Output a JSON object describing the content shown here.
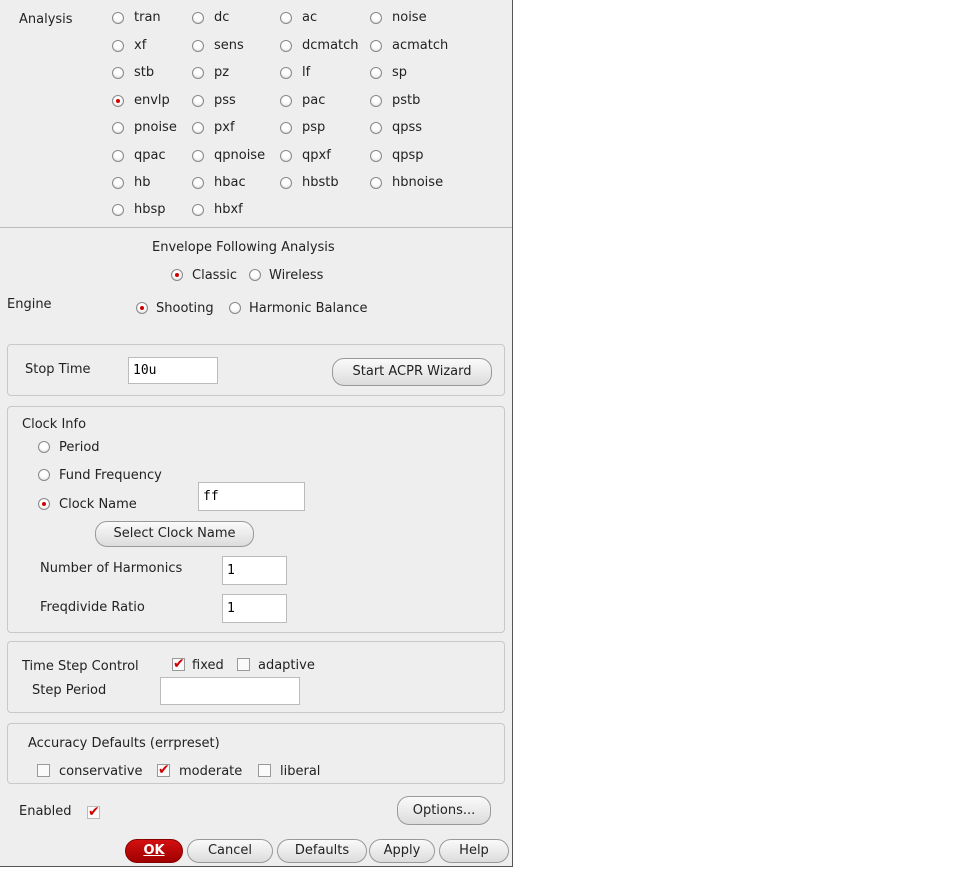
{
  "analysis": {
    "label": "Analysis",
    "selected": "envlp",
    "options": [
      [
        "tran",
        "dc",
        "ac",
        "noise"
      ],
      [
        "xf",
        "sens",
        "dcmatch",
        "acmatch"
      ],
      [
        "stb",
        "pz",
        "lf",
        "sp"
      ],
      [
        "envlp",
        "pss",
        "pac",
        "pstb"
      ],
      [
        "pnoise",
        "pxf",
        "psp",
        "qpss"
      ],
      [
        "qpac",
        "qpnoise",
        "qpxf",
        "qpsp"
      ],
      [
        "hb",
        "hbac",
        "hbstb",
        "hbnoise"
      ],
      [
        "hbsp",
        "hbxf"
      ]
    ]
  },
  "envelope": {
    "title": "Envelope Following Analysis",
    "classic": "Classic",
    "wireless": "Wireless",
    "mode_selected": "Classic",
    "engine_label": "Engine",
    "shooting": "Shooting",
    "harmonic_balance": "Harmonic Balance",
    "engine_selected": "Shooting"
  },
  "stop": {
    "label": "Stop Time",
    "value": "10u",
    "acpr_button": "Start ACPR Wizard"
  },
  "clock": {
    "title": "Clock Info",
    "period": "Period",
    "fund_frequency": "Fund Frequency",
    "clock_name": "Clock Name",
    "selected": "Clock Name",
    "clock_name_value": "ff",
    "select_button": "Select Clock Name",
    "harmonics_label": "Number of Harmonics",
    "harmonics_value": "1",
    "freqdivide_label": "Freqdivide Ratio",
    "freqdivide_value": "1"
  },
  "timestep": {
    "label": "Time Step Control",
    "fixed": "fixed",
    "fixed_checked": true,
    "adaptive": "adaptive",
    "adaptive_checked": false,
    "step_period_label": "Step Period",
    "step_period_value": ""
  },
  "accuracy": {
    "title": "Accuracy Defaults (errpreset)",
    "conservative": "conservative",
    "moderate": "moderate",
    "liberal": "liberal",
    "selected": "moderate"
  },
  "enabled": {
    "label": "Enabled",
    "checked": true
  },
  "buttons": {
    "options": "Options...",
    "ok": "OK",
    "cancel": "Cancel",
    "defaults": "Defaults",
    "apply": "Apply",
    "help": "Help"
  },
  "colors": {
    "accent": "#d00000",
    "background": "#eeeeee"
  }
}
